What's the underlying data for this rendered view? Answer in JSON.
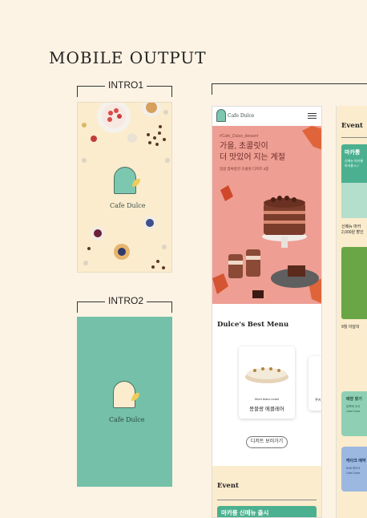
{
  "heading": "MOBILE OUTPUT",
  "intro1": {
    "label": "INTRO1",
    "logo_small": "dessert cafe",
    "logo": "Cafe Dulce"
  },
  "intro2": {
    "label": "INTRO2",
    "logo_small": "dessert cafe",
    "logo": "Cafe Dulce"
  },
  "phone": {
    "brand": "Cafe Dulce",
    "hero": {
      "hashtag": "#Cafe_Dulce_dessert",
      "title_line1": "가을, 초콜릿이",
      "title_line2": "더 맛있어 지는 계절",
      "subtitle": "달콤 쌉싸름한 초콜릿 디저트 3종"
    },
    "best_menu": {
      "title": "Dulce's Best Menu",
      "item_en": "Mont blanc eclair",
      "item_ko": "몽블랑 에클레어",
      "second_partial": "쿠키"
    },
    "more_button": "디저트 보러가기",
    "event": {
      "title": "Event",
      "banner": "마카롱 신메뉴 출시"
    }
  },
  "phone2": {
    "event_title": "Event",
    "banner1": "마카롱",
    "banner1_sub1": "신메뉴 마카롱",
    "banner1_sub2": "마카롱 6,2",
    "text1a": "신메뉴 마카",
    "text1b": "2,000원 할인",
    "text2": "9월 이달의",
    "card1a": "매장 찾기",
    "card1b": "집콕에 주어",
    "card1c": "Cafe Dulce",
    "card2a": "케이크 예약",
    "card2b": "5/48 케이크",
    "card2c": "Cafe Dulce"
  },
  "colors": {
    "background": "#fdf3e4",
    "mint": "#74c0a8",
    "cream": "#fbeccd",
    "hero_pink": "#ee9e93",
    "accent_green": "#4bb08f"
  }
}
